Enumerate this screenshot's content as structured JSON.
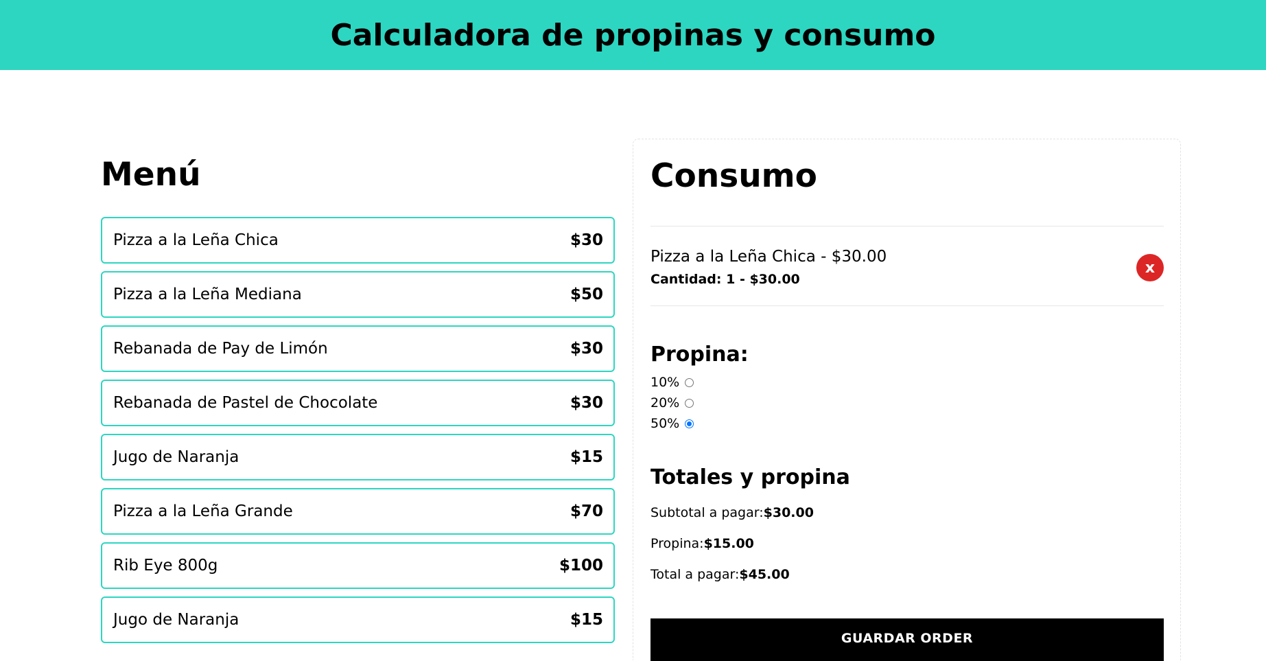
{
  "header": {
    "title": "Calculadora de propinas y consumo"
  },
  "menu": {
    "title": "Menú",
    "items": [
      {
        "name": "Pizza a la Leña Chica",
        "price": "$30"
      },
      {
        "name": "Pizza a la Leña Mediana",
        "price": "$50"
      },
      {
        "name": "Rebanada de Pay de Limón",
        "price": "$30"
      },
      {
        "name": "Rebanada de Pastel de Chocolate",
        "price": "$30"
      },
      {
        "name": "Jugo de Naranja",
        "price": "$15"
      },
      {
        "name": "Pizza a la Leña Grande",
        "price": "$70"
      },
      {
        "name": "Rib Eye 800g",
        "price": "$100"
      },
      {
        "name": "Jugo de Naranja",
        "price": "$15"
      }
    ]
  },
  "consumo": {
    "title": "Consumo",
    "order_items": [
      {
        "description": "Pizza a la Leña Chica - $30.00",
        "quantity_line": "Cantidad: 1 - $30.00",
        "remove_label": "x"
      }
    ],
    "tip": {
      "title": "Propina:",
      "options": [
        {
          "label": "10%",
          "selected": false
        },
        {
          "label": "20%",
          "selected": false
        },
        {
          "label": "50%",
          "selected": true
        }
      ]
    },
    "totals": {
      "title": "Totales y propina",
      "subtotal_label": "Subtotal a pagar:",
      "subtotal_value": "$30.00",
      "tip_label": "Propina:",
      "tip_value": "$15.00",
      "total_label": "Total a pagar:",
      "total_value": "$45.00"
    },
    "save_button": "GUARDAR ORDER"
  },
  "colors": {
    "accent": "#2dd6c1",
    "remove": "#dc2626",
    "radio_checked": "#0075ff",
    "button": "#000000"
  }
}
